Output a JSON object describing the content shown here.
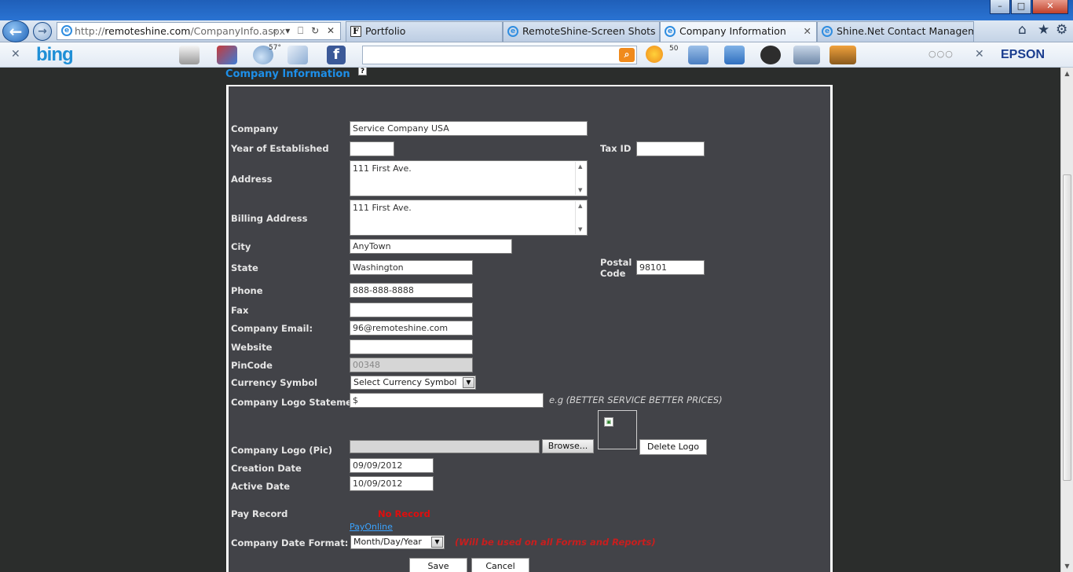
{
  "browser": {
    "address": {
      "prefix": "http://",
      "domain": "remoteshine.com",
      "path": "/CompanyInfo.aspx",
      "tools": "⌕ ▾ ⎕ ↻ ✕"
    },
    "back_label": "←",
    "forward_label": "→",
    "tabs": [
      {
        "label": "Portfolio",
        "icon": "F",
        "active": false
      },
      {
        "label": "RemoteShine-Screen Shots",
        "icon": "e",
        "active": false
      },
      {
        "label": "Company Information",
        "icon": "e",
        "active": true,
        "close": "✕"
      },
      {
        "label": "Shine.Net Contact Manageme...",
        "icon": "e",
        "active": false
      }
    ],
    "window_buttons": {
      "minimize": "–",
      "maximize": "□",
      "close": "✕"
    },
    "nav_icons": {
      "home": "⌂",
      "favorites": "★",
      "tools": "⚙"
    }
  },
  "toolbar": {
    "close_x": "✕",
    "bing_label": "bing",
    "weather_temp": "57°",
    "mail_count": "50",
    "search_button": "⌕",
    "more_dots": "○○○",
    "close_x2": "✕",
    "epson_label": "EPSON"
  },
  "page": {
    "title": "Company Information",
    "help_icon": "?",
    "fields": {
      "company": {
        "label": "Company",
        "value": "Service Company USA"
      },
      "year": {
        "label": "Year of Established",
        "value": ""
      },
      "tax_id": {
        "label": "Tax ID",
        "value": ""
      },
      "address": {
        "label": "Address",
        "value": "111 First Ave."
      },
      "billing_address": {
        "label": "Billing Address",
        "value": "111 First Ave."
      },
      "city": {
        "label": "City",
        "value": "AnyTown"
      },
      "state": {
        "label": "State",
        "value": "Washington"
      },
      "postal_code": {
        "label_line1": "Postal",
        "label_line2": "Code",
        "value": "98101"
      },
      "phone": {
        "label": "Phone",
        "value": "888-888-8888"
      },
      "fax": {
        "label": "Fax",
        "value": ""
      },
      "email": {
        "label": "Company Email:",
        "value": "96@remoteshine.com"
      },
      "website": {
        "label": "Website",
        "value": ""
      },
      "pincode": {
        "label": "PinCode",
        "value": "00348"
      },
      "currency": {
        "label": "Currency Symbol",
        "value": "Select Currency Symbol"
      },
      "logo_statement": {
        "label": "Company Logo Statement",
        "value": "$",
        "hint": "e.g (BETTER SERVICE BETTER PRICES)"
      },
      "logo_pic": {
        "label": "Company Logo (Pic)",
        "browse": "Browse...",
        "delete": "Delete Logo"
      },
      "creation_date": {
        "label": "Creation Date",
        "value": "09/09/2012"
      },
      "active_date": {
        "label": "Active Date",
        "value": "10/09/2012"
      },
      "pay_record": {
        "label": "Pay Record",
        "status": "No Record",
        "link": "PayOnline"
      },
      "date_format": {
        "label": "Company Date Format:",
        "value": "Month/Day/Year",
        "hint": "(Will be used on all Forms and Reports)"
      }
    },
    "buttons": {
      "save": "Save",
      "cancel": "Cancel"
    }
  },
  "colors": {
    "title_blue": "#1e8fe8",
    "panel_bg": "#424348",
    "page_bg": "#2b2d2c",
    "warning_red": "#e00d0d"
  }
}
